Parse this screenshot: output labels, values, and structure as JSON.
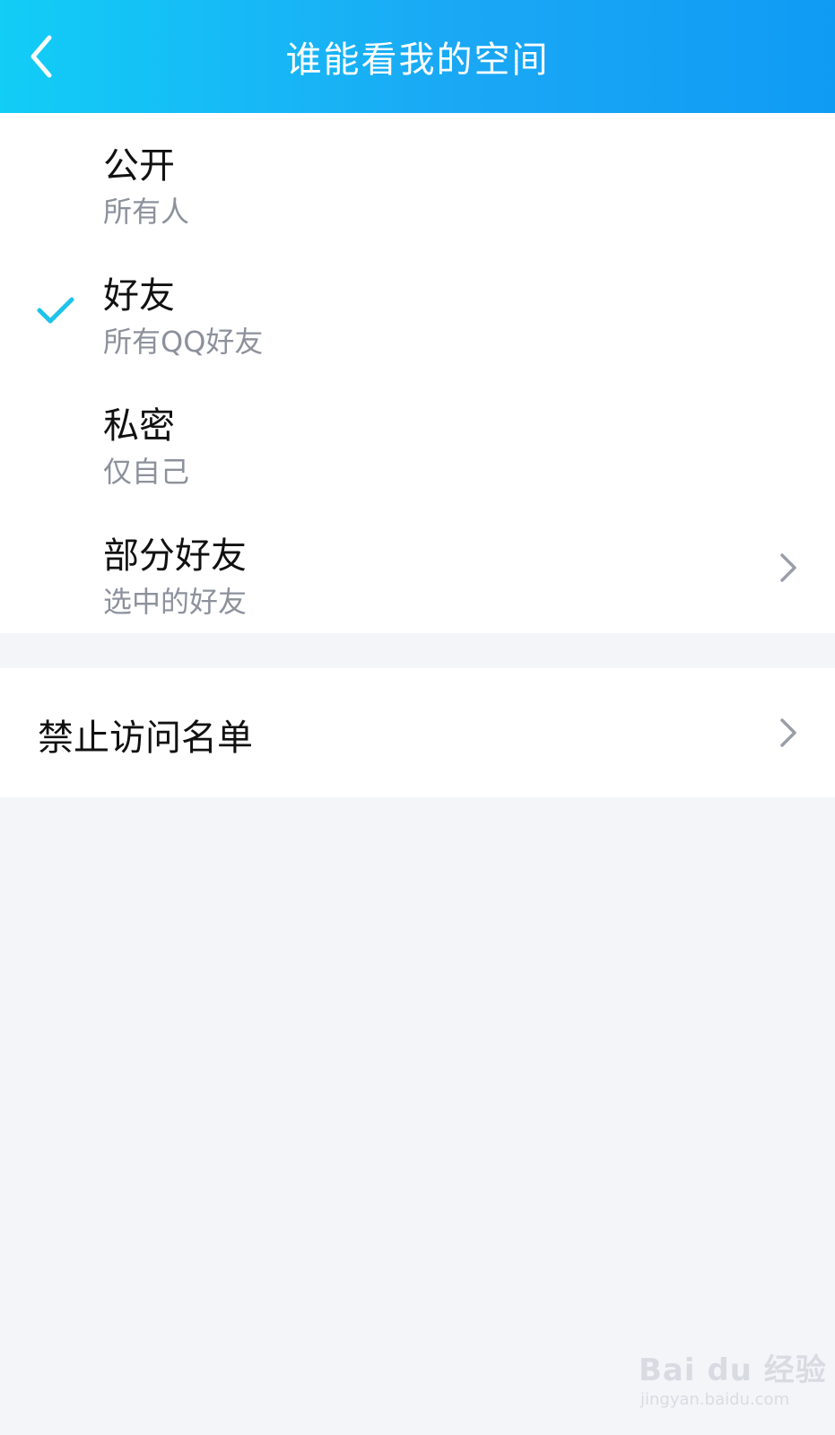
{
  "header": {
    "title": "谁能看我的空间",
    "back_icon": "chevron-left-icon"
  },
  "options": [
    {
      "title": "公开",
      "subtitle": "所有人",
      "selected": false,
      "has_chevron": false
    },
    {
      "title": "好友",
      "subtitle": "所有QQ好友",
      "selected": true,
      "has_chevron": false
    },
    {
      "title": "私密",
      "subtitle": "仅自己",
      "selected": false,
      "has_chevron": false
    },
    {
      "title": "部分好友",
      "subtitle": "选中的好友",
      "selected": false,
      "has_chevron": true
    }
  ],
  "blocklist": {
    "label": "禁止访问名单"
  },
  "watermark": {
    "logo": "Bai du 经验",
    "url": "jingyan.baidu.com"
  },
  "colors": {
    "header_start": "#12cdf6",
    "header_end": "#0f9bf4",
    "check": "#1fc3ea",
    "subtitle": "#8c919c",
    "background": "#f4f5f9"
  }
}
